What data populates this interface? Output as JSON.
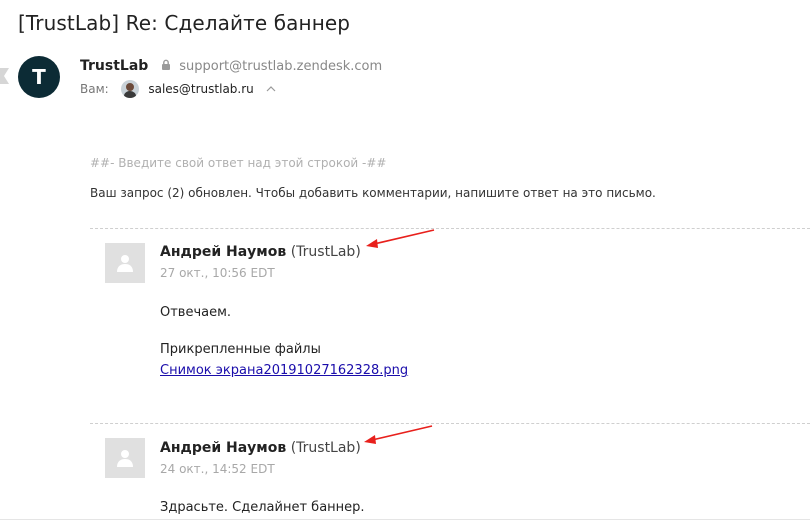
{
  "subject": "[TrustLab] Re: Сделайте баннер",
  "sender": {
    "avatar_letter": "T",
    "name": "TrustLab",
    "email": "support@trustlab.zendesk.com"
  },
  "recipient": {
    "label": "Вам:",
    "email": "sales@trustlab.ru"
  },
  "reply_delimiter": "##- Введите свой ответ над этой строкой -##",
  "update_note": "Ваш запрос (2) обновлен. Чтобы добавить комментарии, напишите ответ на это письмо.",
  "comments": [
    {
      "author": "Андрей Наумов",
      "org": "(TrustLab)",
      "date": "27 окт., 10:56 EDT",
      "body": "Отвечаем.",
      "attachments_label": "Прикрепленные файлы",
      "attachment": "Снимок экрана20191027162328.png"
    },
    {
      "author": "Андрей Наумов",
      "org": "(TrustLab)",
      "date": "24 окт., 14:52 EDT",
      "body": "Здрасьте. Сделайнет баннер."
    }
  ],
  "colors": {
    "avatar_bg": "#0c2b35",
    "link": "#1a0dab",
    "annotation_arrow": "#e8201c"
  }
}
